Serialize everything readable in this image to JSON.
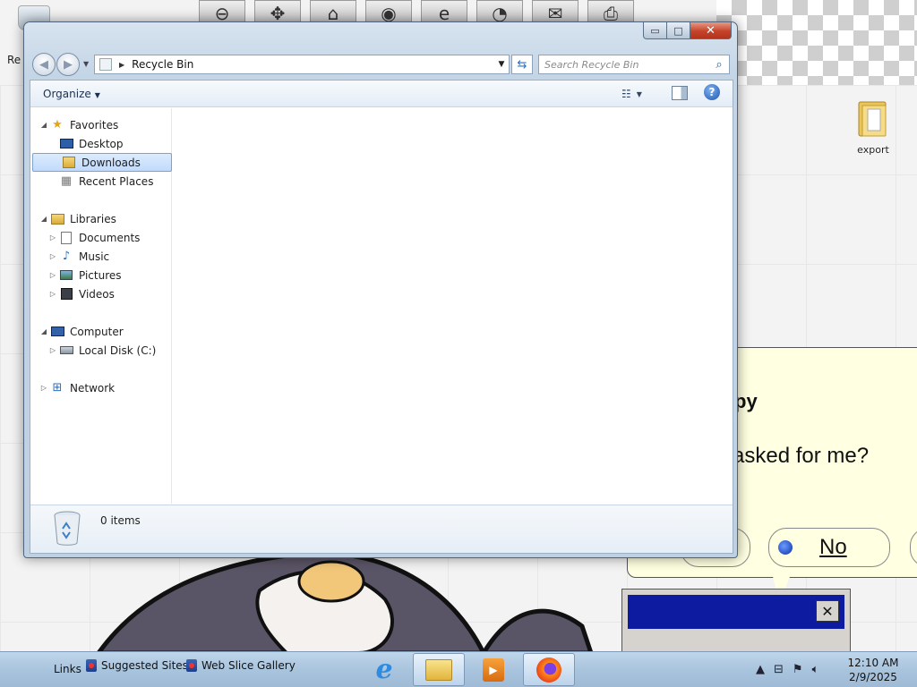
{
  "window": {
    "title": "Recycle Bin",
    "controls": {
      "minimize": "▭",
      "maximize": "□",
      "close": "✕"
    }
  },
  "navigation": {
    "back_icon": "arrow-left-icon",
    "forward_icon": "arrow-right-icon",
    "address_path": "Recycle Bin",
    "search_placeholder": "Search Recycle Bin"
  },
  "command_bar": {
    "organize_label": "Organize"
  },
  "nav_pane": {
    "items": [
      {
        "label": "Favorites",
        "icon": "star-icon"
      },
      {
        "label": "Desktop",
        "icon": "desktop-icon"
      },
      {
        "label": "Downloads",
        "icon": "downloads-folder-icon",
        "selected": true
      },
      {
        "label": "Recent Places",
        "icon": "recent-places-icon"
      },
      {
        "label": "Libraries",
        "icon": "libraries-icon"
      },
      {
        "label": "Documents",
        "icon": "documents-icon"
      },
      {
        "label": "Music",
        "icon": "music-icon"
      },
      {
        "label": "Pictures",
        "icon": "pictures-icon"
      },
      {
        "label": "Videos",
        "icon": "videos-icon"
      },
      {
        "label": "Computer",
        "icon": "computer-icon"
      },
      {
        "label": "Local Disk (C:)",
        "icon": "disk-icon"
      },
      {
        "label": "Network",
        "icon": "network-icon"
      }
    ]
  },
  "details_pane": {
    "item_count": "0 items"
  },
  "desktop": {
    "left_label": "Re",
    "export_label": "export",
    "dialog": {
      "heading": "py",
      "question": "asked for me?",
      "no_label": "No",
      "close_icon": "✕"
    }
  },
  "taskbar": {
    "links_label": "Links",
    "link_items": [
      "Suggested Sites",
      "Web Slice Gallery"
    ],
    "tasks": [
      "internet-explorer-icon",
      "windows-explorer-icon",
      "media-player-icon",
      "firefox-icon"
    ],
    "clock_time": "12:10 AM",
    "clock_date": "2/9/2025"
  },
  "colors": {
    "window_frame": "#c4d5e6",
    "close_button": "#c5432a",
    "selection": "#c1dbfc",
    "taskbar": "#a9c4dd",
    "dialog_bg": "#ffffe1"
  }
}
